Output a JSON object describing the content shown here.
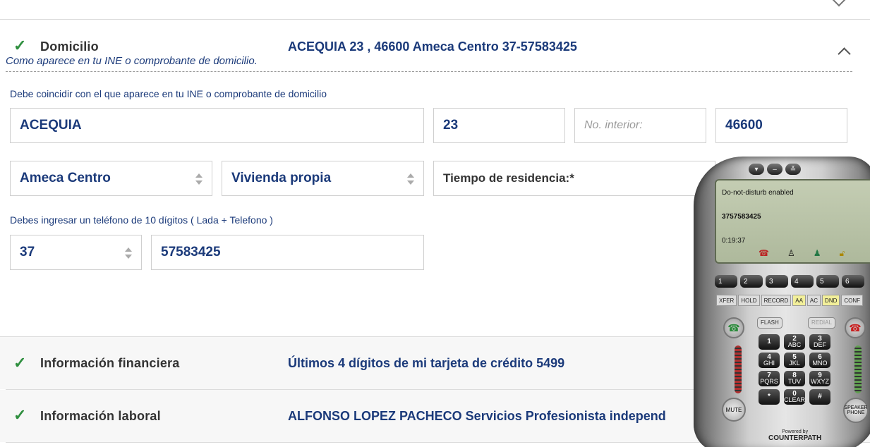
{
  "domicilio": {
    "title": "Domicilio",
    "summary": "ACEQUIA 23 , 46600 Ameca Centro 37-57583425",
    "subtitle": "Como aparece en tu INE o comprobante de domicilio.",
    "hint": "Debe coincidir con el que aparece en tu INE o comprobante de domicilio",
    "street": "ACEQUIA",
    "exterior_number": "23",
    "interior_placeholder": "No. interior:",
    "postal_code": "46600",
    "colonia": "Ameca Centro",
    "housing_type": "Vivienda propia",
    "residence_label": "Tiempo de residencia:*",
    "phone_hint": "Debes ingresar un teléfono de 10 dígitos ( Lada + Telefono )",
    "lada": "37",
    "phone": "57583425"
  },
  "financiera": {
    "title": "Información financiera",
    "summary": "Últimos 4 dígitos de mi tarjeta de crédito 5499"
  },
  "laboral": {
    "title": "Información laboral",
    "summary": "ALFONSO LOPEZ PACHECO Servicios Profesionista independ"
  },
  "softphone": {
    "status": "Do-not-disturb enabled",
    "number": "3757583425",
    "timer": "0:19:37",
    "lines": [
      "1",
      "2",
      "3",
      "4",
      "5",
      "6"
    ],
    "functions": [
      "XFER",
      "HOLD",
      "RECORD",
      "AA",
      "AC",
      "DND",
      "CONF"
    ],
    "flash": "FLASH",
    "redial": "REDIAL",
    "keys": [
      {
        "d": "1",
        "l": ""
      },
      {
        "d": "2",
        "l": "ABC"
      },
      {
        "d": "3",
        "l": "DEF"
      },
      {
        "d": "4",
        "l": "GHI"
      },
      {
        "d": "5",
        "l": "JKL"
      },
      {
        "d": "6",
        "l": "MNO"
      },
      {
        "d": "7",
        "l": "PQRS"
      },
      {
        "d": "8",
        "l": "TUV"
      },
      {
        "d": "9",
        "l": "WXYZ"
      },
      {
        "d": "*",
        "l": ""
      },
      {
        "d": "0",
        "l": "CLEAR"
      },
      {
        "d": "#",
        "l": ""
      }
    ],
    "mute": "MUTE",
    "speaker": "SPEAKER PHONE",
    "powered": "Powered by",
    "brand": "COUNTERPATH"
  }
}
